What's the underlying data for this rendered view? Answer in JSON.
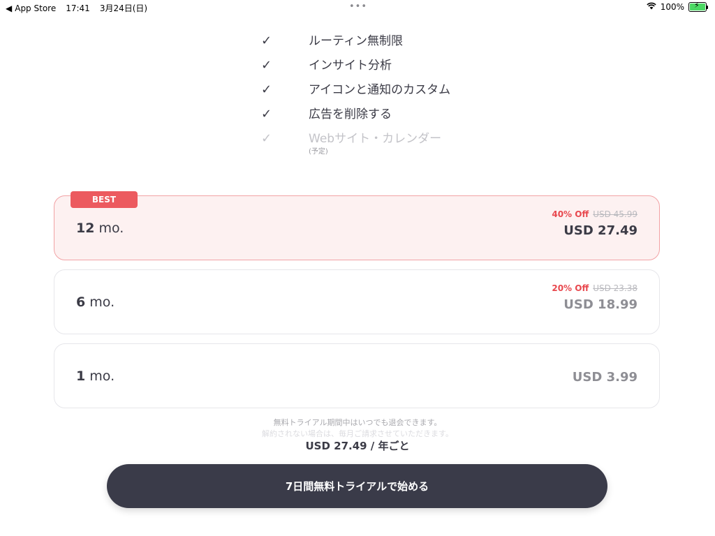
{
  "status_bar": {
    "back_label": "App Store",
    "time": "17:41",
    "date": "3月24日(日)",
    "battery_percent": "100%",
    "battery_level": 1.0,
    "multitask_dots": "•••"
  },
  "features": [
    {
      "label": "ルーティン無制限",
      "sub": "",
      "enabled": true
    },
    {
      "label": "インサイト分析",
      "sub": "",
      "enabled": true
    },
    {
      "label": "アイコンと通知のカスタム",
      "sub": "",
      "enabled": true
    },
    {
      "label": "広告を削除する",
      "sub": "",
      "enabled": true
    },
    {
      "label": "Webサイト・カレンダー",
      "sub": "(予定)",
      "enabled": false
    }
  ],
  "check_glyph": "✓",
  "plans": [
    {
      "badge": "BEST",
      "duration_num": "12",
      "duration_unit": " mo.",
      "discount": "40% Off",
      "original": "USD 45.99",
      "price": "USD 27.49",
      "selected": true
    },
    {
      "badge": "",
      "duration_num": "6",
      "duration_unit": " mo.",
      "discount": "20% Off",
      "original": "USD 23.38",
      "price": "USD 18.99",
      "selected": false
    },
    {
      "badge": "",
      "duration_num": "1",
      "duration_unit": " mo.",
      "discount": "",
      "original": "",
      "price": "USD 3.99",
      "selected": false
    }
  ],
  "fine_print": {
    "line1": "無料トライアル期間中はいつでも退会できます。",
    "line2": "解約されない場合は、毎月ご請求させていただきます。"
  },
  "summary": "USD 27.49 / 年ごと",
  "cta_label": "7日間無料トライアルで始める",
  "colors": {
    "accent_red": "#ec5a5f",
    "button_dark": "#3a3b49",
    "best_bg": "#fdf1f1",
    "battery_green": "#4cd964"
  }
}
